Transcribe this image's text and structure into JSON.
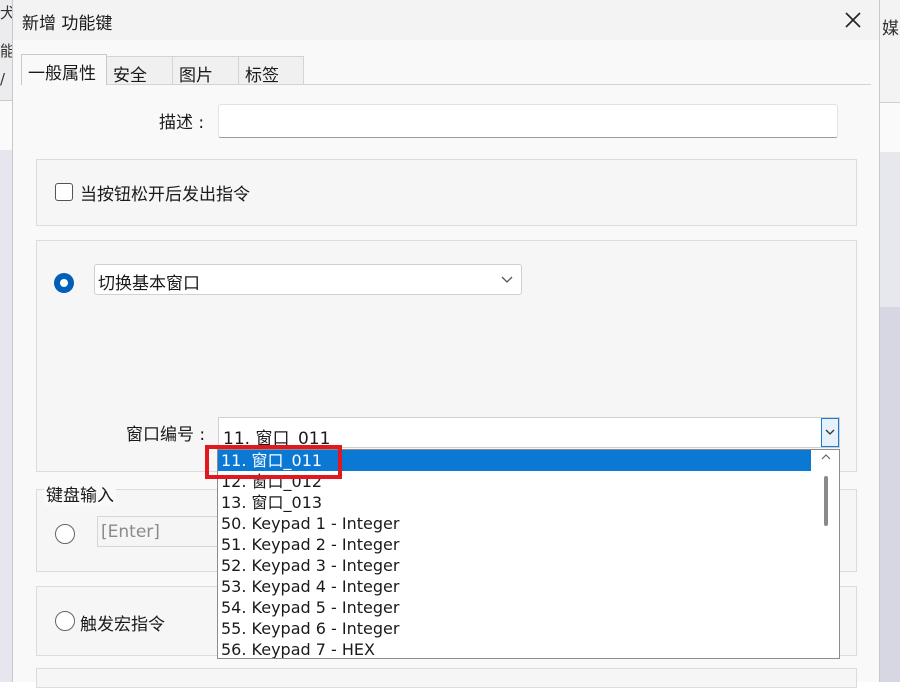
{
  "background": {
    "right_glyph": "媒",
    "left_glyphs": [
      "犬",
      "能",
      "/"
    ]
  },
  "dialog": {
    "title": "新增 功能键",
    "tabs": [
      "一般属性",
      "安全",
      "图片",
      "标签"
    ],
    "description": {
      "label": "描述 :",
      "value": ""
    },
    "release_checkbox": {
      "label": "当按钮松开后发出指令",
      "checked": false
    },
    "action_select": {
      "value": "切换基本窗口",
      "selected": true
    },
    "window_number": {
      "label": "窗口编号 :",
      "value": "11. 窗口_011"
    },
    "keyboard": {
      "legend": "键盘输入",
      "value": "[Enter]",
      "selected": false
    },
    "macro": {
      "label": "触发宏指令",
      "selected": false
    },
    "dropdown": {
      "items": [
        "11. 窗口_011",
        "12. 窗口_012",
        "13. 窗口_013",
        "50. Keypad 1 - Integer",
        "51. Keypad 2 - Integer",
        "52. Keypad 3 - Integer",
        "53. Keypad 4 - Integer",
        "54. Keypad 5 - Integer",
        "55. Keypad 6 - Integer",
        "56. Keypad 7 - HEX"
      ],
      "selected_index": 0
    }
  },
  "colors": {
    "accent": "#005fb8",
    "selection": "#0b78d4",
    "highlight_box": "#e3171e"
  },
  "icons": {
    "close": "close-icon",
    "chevron": "chevron-down-icon"
  }
}
